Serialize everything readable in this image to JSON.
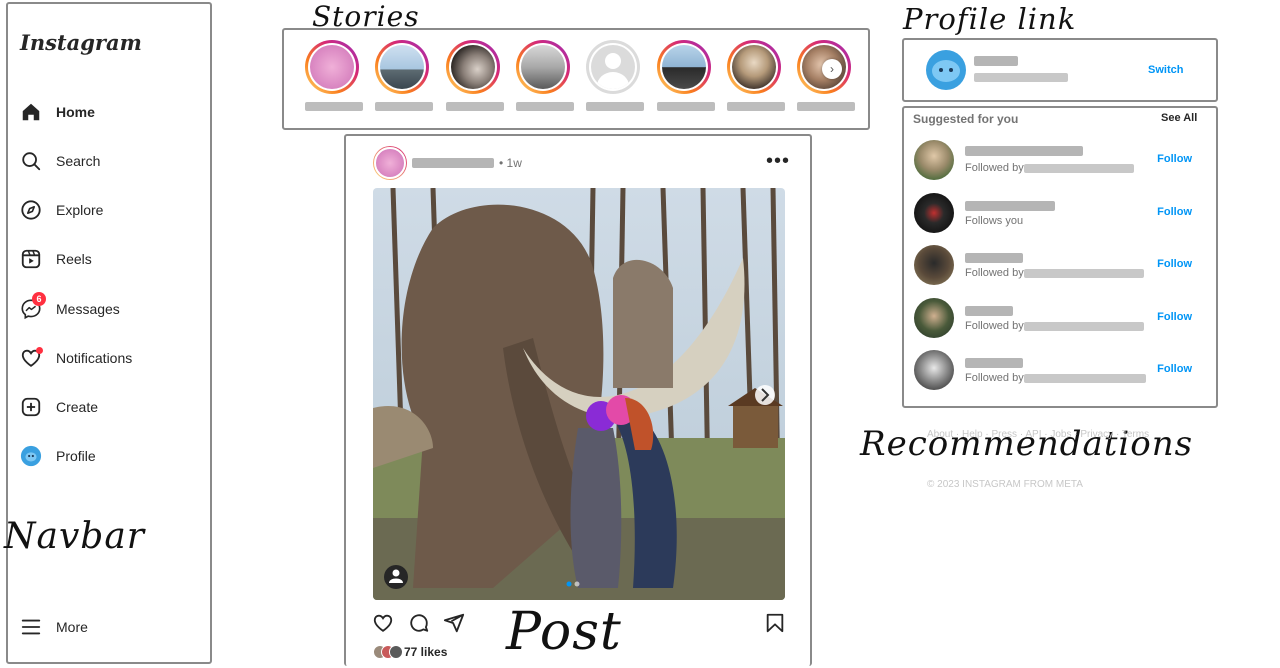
{
  "annotations": {
    "stories": "Stories",
    "profile_link": "Profile link",
    "navbar": "Navbar",
    "post": "Post",
    "recommendations": "Recommendations"
  },
  "sidebar": {
    "logo": "Instagram",
    "items": [
      {
        "label": "Home",
        "icon": "home-icon"
      },
      {
        "label": "Search",
        "icon": "search-icon"
      },
      {
        "label": "Explore",
        "icon": "compass-icon"
      },
      {
        "label": "Reels",
        "icon": "reels-icon"
      },
      {
        "label": "Messages",
        "icon": "messenger-icon",
        "badge": "6"
      },
      {
        "label": "Notifications",
        "icon": "heart-icon"
      },
      {
        "label": "Create",
        "icon": "plus-square-icon"
      },
      {
        "label": "Profile",
        "icon": "avatar-icon"
      }
    ],
    "more": "More"
  },
  "post": {
    "time": "• 1w",
    "likes": "77 likes"
  },
  "profile": {
    "switch": "Switch"
  },
  "suggestions": {
    "title": "Suggested for you",
    "see_all": "See All",
    "items": [
      {
        "subtitle": "Followed by",
        "follow": "Follow"
      },
      {
        "subtitle": "Follows you",
        "follow": "Follow"
      },
      {
        "subtitle": "Followed by",
        "follow": "Follow"
      },
      {
        "subtitle": "Followed by",
        "follow": "Follow"
      },
      {
        "subtitle": "Followed by",
        "follow": "Follow"
      }
    ]
  },
  "footer": {
    "links": "About · Help · Press · API · Jobs · Privacy · Terms",
    "copyright": "© 2023 INSTAGRAM FROM META"
  },
  "colors": {
    "accent": "#0095f6",
    "notification": "#ff3040",
    "text": "#262626",
    "muted": "#737373",
    "sketch_border": "#8a8a8a"
  }
}
